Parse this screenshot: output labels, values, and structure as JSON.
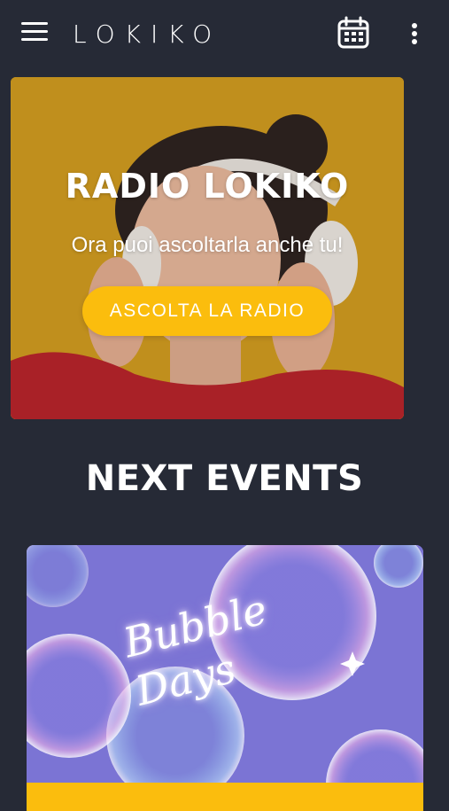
{
  "header": {
    "logo_text": "LOKIKO",
    "icons": [
      "menu-icon",
      "calendar-icon",
      "more-vert-icon"
    ]
  },
  "radio_banner": {
    "title": "RADIO LOKIKO",
    "subtitle": "Ora puoi ascoltarla anche tu!",
    "button_label": "ASCOLTA LA RADIO",
    "button_color": "#fbbd0d",
    "background_color": "#cf9a1d"
  },
  "events_section": {
    "title": "NEXT EVENTS",
    "events": [
      {
        "name": "Bubble Days"
      }
    ]
  },
  "theme": {
    "background": "#262a36",
    "accent": "#fbbd0d"
  }
}
